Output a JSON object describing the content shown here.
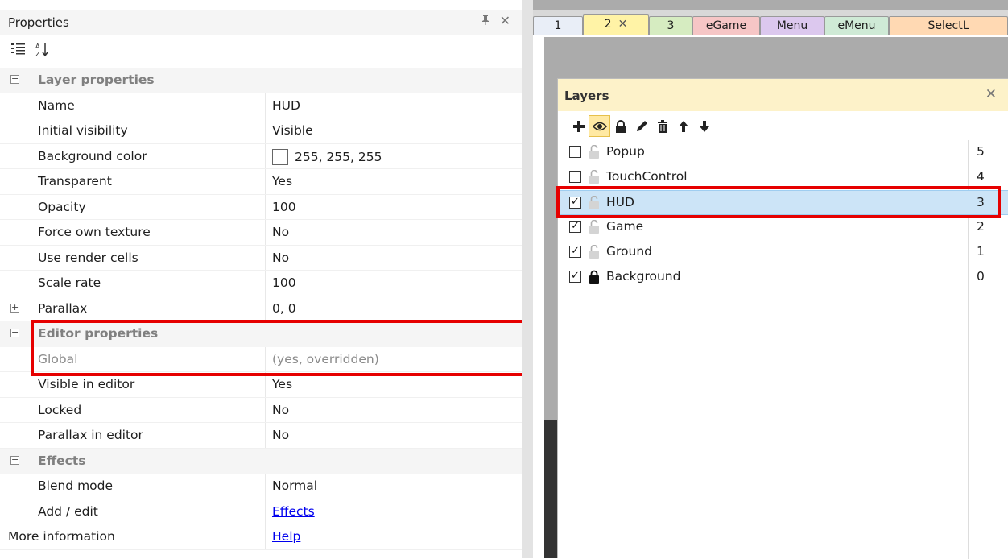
{
  "properties_panel": {
    "title": "Properties",
    "pin_icon": "pin-icon",
    "close_icon": "close-icon",
    "toolbar": {
      "categorized_icon": "categorized-icon",
      "alphabetical_icon": "sort-az-icon"
    },
    "rows": [
      {
        "name": "Layer properties",
        "type": "category",
        "toggle": "⊟"
      },
      {
        "name": "Name",
        "value": "HUD"
      },
      {
        "name": "Initial visibility",
        "value": "Visible"
      },
      {
        "name": "Background color",
        "value": "255, 255, 255",
        "swatch": "#ffffff"
      },
      {
        "name": "Transparent",
        "value": "Yes"
      },
      {
        "name": "Opacity",
        "value": "100"
      },
      {
        "name": "Force own texture",
        "value": "No"
      },
      {
        "name": "Use render cells",
        "value": "No"
      },
      {
        "name": "Scale rate",
        "value": "100"
      },
      {
        "name": "Parallax",
        "value": "0, 0",
        "toggle": "⊞"
      },
      {
        "name": "Editor properties",
        "type": "category",
        "toggle": "⊟"
      },
      {
        "name": "Global",
        "value": "(yes, overridden)",
        "grey": true
      },
      {
        "name": "Visible in editor",
        "value": "Yes"
      },
      {
        "name": "Locked",
        "value": "No"
      },
      {
        "name": "Parallax in editor",
        "value": "No"
      },
      {
        "name": "Effects",
        "type": "category",
        "toggle": "⊟"
      },
      {
        "name": "Blend mode",
        "value": "Normal"
      },
      {
        "name": "Add / edit",
        "value": "Effects",
        "link": true
      },
      {
        "name": "More information",
        "value": "Help",
        "link": true,
        "top": true
      }
    ]
  },
  "tabs": [
    {
      "label": "1",
      "color": "#e9eef7",
      "active": false
    },
    {
      "label": "2",
      "color": "#fff3a6",
      "active": true,
      "closable": true
    },
    {
      "label": "3",
      "color": "#d6ecc1",
      "active": false
    },
    {
      "label": "eGame",
      "color": "#f6c6c6",
      "active": false
    },
    {
      "label": "Menu",
      "color": "#dcc8ee",
      "active": false
    },
    {
      "label": "eMenu",
      "color": "#cfead6",
      "active": false
    },
    {
      "label": "SelectL",
      "color": "#ffd9b3",
      "active": false
    }
  ],
  "layers_window": {
    "title": "Layers",
    "close_icon": "close-icon",
    "toolbar": [
      "add-icon",
      "eye-icon",
      "lock-icon",
      "pencil-icon",
      "trash-icon",
      "arrow-up-icon",
      "arrow-down-icon"
    ],
    "layers": [
      {
        "name": "Popup",
        "index": "5",
        "checked": false,
        "locked": false
      },
      {
        "name": "TouchControl",
        "index": "4",
        "checked": false,
        "locked": false
      },
      {
        "name": "HUD",
        "index": "3",
        "checked": true,
        "locked": false,
        "selected": true
      },
      {
        "name": "Game",
        "index": "2",
        "checked": true,
        "locked": false
      },
      {
        "name": "Ground",
        "index": "1",
        "checked": true,
        "locked": false
      },
      {
        "name": "Background",
        "index": "0",
        "checked": true,
        "locked": true
      }
    ]
  },
  "colors": {
    "highlight": "#e60000",
    "selection": "#cce4f7",
    "layers_title": "#fdf2c9"
  }
}
